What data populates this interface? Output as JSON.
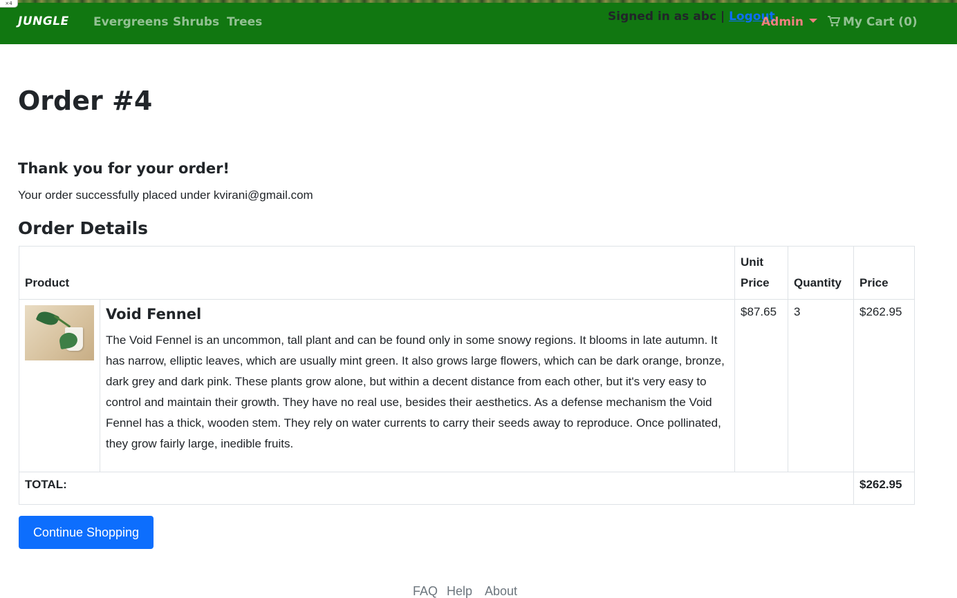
{
  "corner_tag": "×4",
  "navbar": {
    "brand": "JUNGLE",
    "links": [
      "Evergreens",
      "Shrubs",
      "Trees"
    ],
    "signed_in_text": "Signed in as abc |",
    "logout_label": "Logout",
    "admin_label": "Admin",
    "cart_label": "My Cart (0)"
  },
  "main": {
    "title": "Order #4",
    "thanks_heading": "Thank you for your order!",
    "placed_text": "Your order successfully placed under kvirani@gmail.com",
    "details_heading": "Order Details"
  },
  "table": {
    "headers": {
      "product": "Product",
      "unit_price": "Unit Price",
      "quantity": "Quantity",
      "price": "Price"
    },
    "items": [
      {
        "name": "Void Fennel",
        "description": "The Void Fennel is an uncommon, tall plant and can be found only in some snowy regions. It blooms in late autumn. It has narrow, elliptic leaves, which are usually mint green. It also grows large flowers, which can be dark orange, bronze, dark grey and dark pink. These plants grow alone, but within a decent distance from each other, but it's very easy to control and maintain their growth. They have no real use, besides their aesthetics. As a defense mechanism the Void Fennel has a thick, wooden stem. They rely on water currents to carry their seeds away to reproduce. Once pollinated, they grow fairly large, inedible fruits.",
        "unit_price": "$87.65",
        "quantity": "3",
        "price": "$262.95"
      }
    ],
    "total_label": "TOTAL:",
    "total_value": "$262.95"
  },
  "continue_label": "Continue Shopping",
  "footer": {
    "links": [
      "FAQ",
      "Help",
      "About"
    ]
  },
  "colors": {
    "navbar_bg": "#117711",
    "primary": "#0d6efd",
    "admin": "#f08080"
  }
}
